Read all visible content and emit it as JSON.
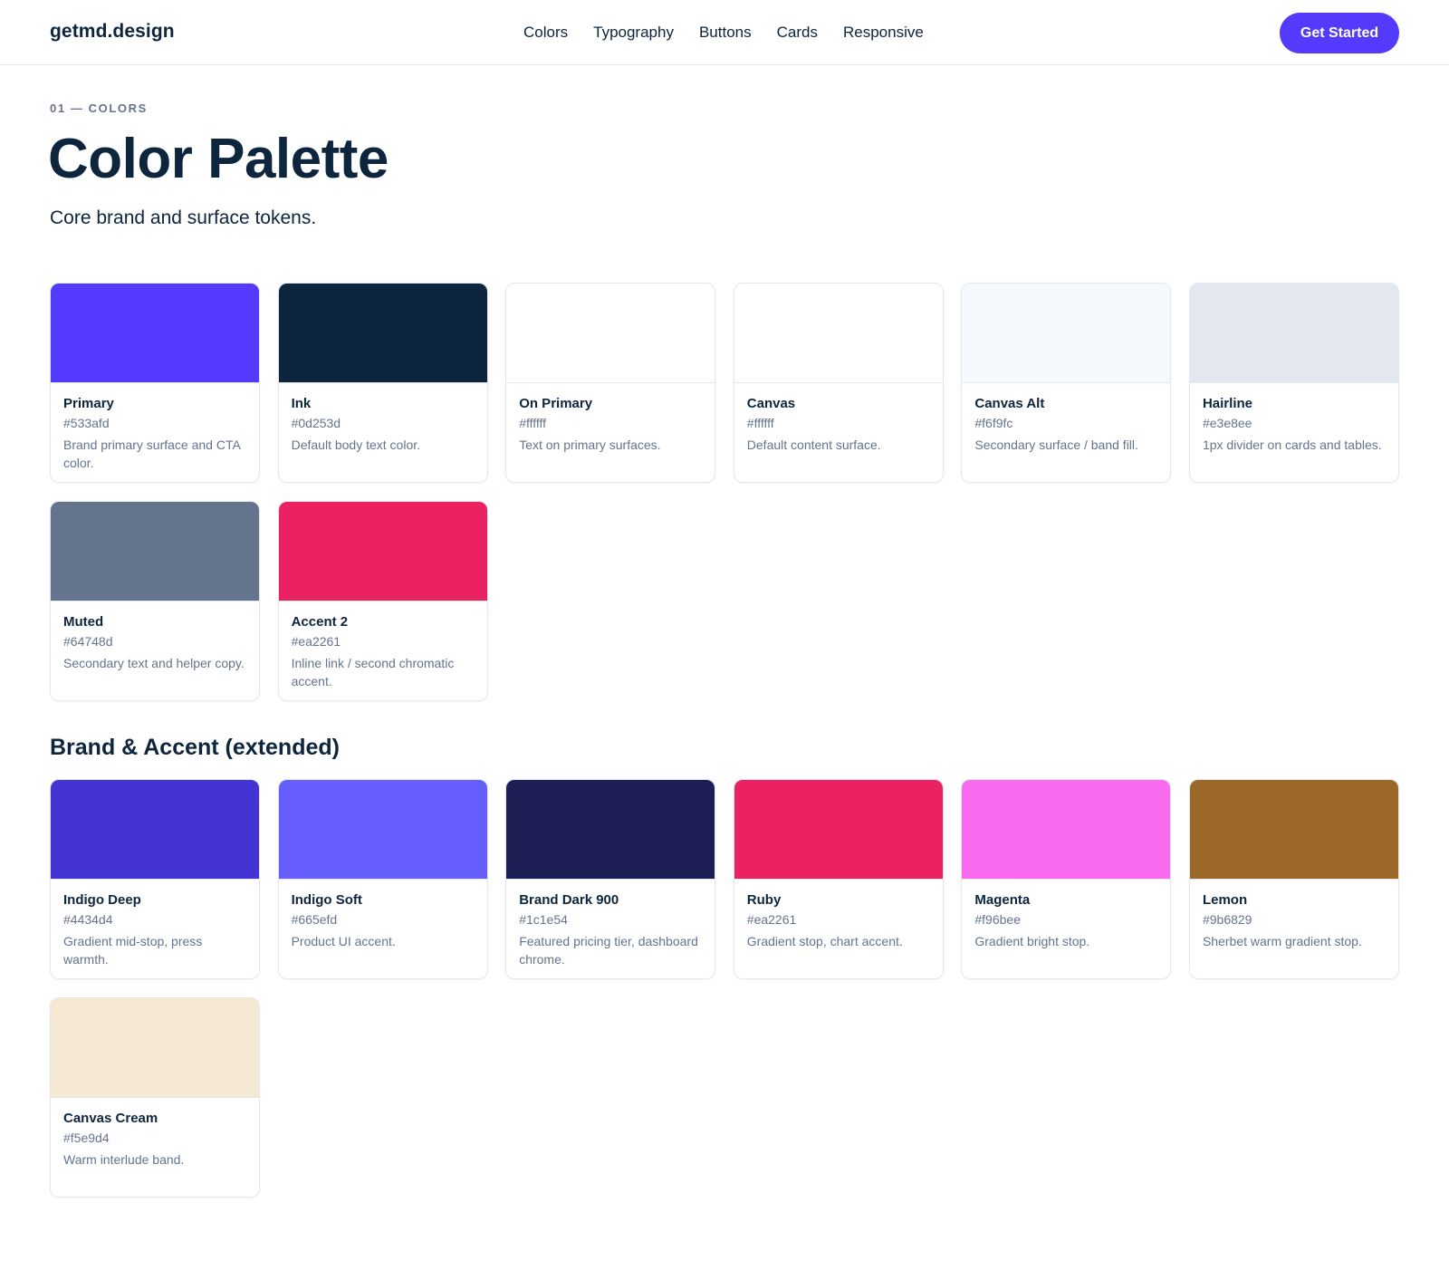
{
  "header": {
    "brand": "getmd.design",
    "nav": [
      "Colors",
      "Typography",
      "Buttons",
      "Cards",
      "Responsive"
    ],
    "cta_label": "Get Started"
  },
  "hero": {
    "eyebrow": "01 — COLORS",
    "title": "Color Palette",
    "subtitle": "Core brand and surface tokens."
  },
  "sections": {
    "extended_heading": "Brand & Accent (extended)"
  },
  "core_swatches": [
    {
      "name": "Primary",
      "hex": "#533afd",
      "desc": "Brand primary surface and CTA color."
    },
    {
      "name": "Ink",
      "hex": "#0d253d",
      "desc": "Default body text color."
    },
    {
      "name": "On Primary",
      "hex": "#ffffff",
      "desc": "Text on primary surfaces."
    },
    {
      "name": "Canvas",
      "hex": "#ffffff",
      "desc": "Default content surface."
    },
    {
      "name": "Canvas Alt",
      "hex": "#f6f9fc",
      "desc": "Secondary surface / band fill."
    },
    {
      "name": "Hairline",
      "hex": "#e3e8ee",
      "desc": "1px divider on cards and tables."
    },
    {
      "name": "Muted",
      "hex": "#64748d",
      "desc": "Secondary text and helper copy."
    },
    {
      "name": "Accent 2",
      "hex": "#ea2261",
      "desc": "Inline link / second chromatic accent."
    }
  ],
  "extended_swatches": [
    {
      "name": "Indigo Deep",
      "hex": "#4434d4",
      "desc": "Gradient mid-stop, press warmth."
    },
    {
      "name": "Indigo Soft",
      "hex": "#665efd",
      "desc": "Product UI accent."
    },
    {
      "name": "Brand Dark 900",
      "hex": "#1c1e54",
      "desc": "Featured pricing tier, dashboard chrome."
    },
    {
      "name": "Ruby",
      "hex": "#ea2261",
      "desc": "Gradient stop, chart accent."
    },
    {
      "name": "Magenta",
      "hex": "#f96bee",
      "desc": "Gradient bright stop."
    },
    {
      "name": "Lemon",
      "hex": "#9b6829",
      "desc": "Sherbet warm gradient stop."
    },
    {
      "name": "Canvas Cream",
      "hex": "#f5e9d4",
      "desc": "Warm interlude band."
    }
  ]
}
